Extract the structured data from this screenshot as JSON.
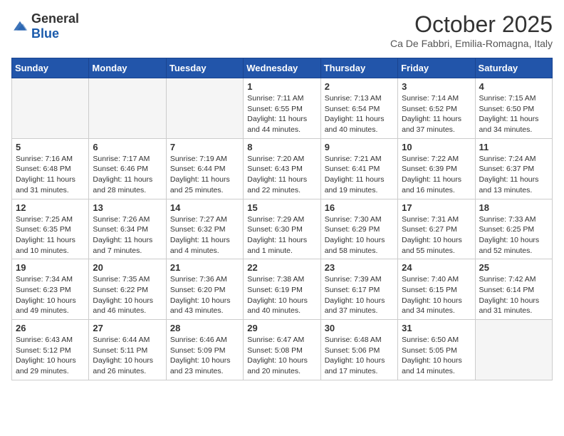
{
  "logo": {
    "general": "General",
    "blue": "Blue"
  },
  "title": "October 2025",
  "subtitle": "Ca De Fabbri, Emilia-Romagna, Italy",
  "days_of_week": [
    "Sunday",
    "Monday",
    "Tuesday",
    "Wednesday",
    "Thursday",
    "Friday",
    "Saturday"
  ],
  "weeks": [
    [
      {
        "day": "",
        "info": "",
        "empty": true
      },
      {
        "day": "",
        "info": "",
        "empty": true
      },
      {
        "day": "",
        "info": "",
        "empty": true
      },
      {
        "day": "1",
        "info": "Sunrise: 7:11 AM\nSunset: 6:55 PM\nDaylight: 11 hours and 44 minutes."
      },
      {
        "day": "2",
        "info": "Sunrise: 7:13 AM\nSunset: 6:54 PM\nDaylight: 11 hours and 40 minutes."
      },
      {
        "day": "3",
        "info": "Sunrise: 7:14 AM\nSunset: 6:52 PM\nDaylight: 11 hours and 37 minutes."
      },
      {
        "day": "4",
        "info": "Sunrise: 7:15 AM\nSunset: 6:50 PM\nDaylight: 11 hours and 34 minutes."
      }
    ],
    [
      {
        "day": "5",
        "info": "Sunrise: 7:16 AM\nSunset: 6:48 PM\nDaylight: 11 hours and 31 minutes."
      },
      {
        "day": "6",
        "info": "Sunrise: 7:17 AM\nSunset: 6:46 PM\nDaylight: 11 hours and 28 minutes."
      },
      {
        "day": "7",
        "info": "Sunrise: 7:19 AM\nSunset: 6:44 PM\nDaylight: 11 hours and 25 minutes."
      },
      {
        "day": "8",
        "info": "Sunrise: 7:20 AM\nSunset: 6:43 PM\nDaylight: 11 hours and 22 minutes."
      },
      {
        "day": "9",
        "info": "Sunrise: 7:21 AM\nSunset: 6:41 PM\nDaylight: 11 hours and 19 minutes."
      },
      {
        "day": "10",
        "info": "Sunrise: 7:22 AM\nSunset: 6:39 PM\nDaylight: 11 hours and 16 minutes."
      },
      {
        "day": "11",
        "info": "Sunrise: 7:24 AM\nSunset: 6:37 PM\nDaylight: 11 hours and 13 minutes."
      }
    ],
    [
      {
        "day": "12",
        "info": "Sunrise: 7:25 AM\nSunset: 6:35 PM\nDaylight: 11 hours and 10 minutes."
      },
      {
        "day": "13",
        "info": "Sunrise: 7:26 AM\nSunset: 6:34 PM\nDaylight: 11 hours and 7 minutes."
      },
      {
        "day": "14",
        "info": "Sunrise: 7:27 AM\nSunset: 6:32 PM\nDaylight: 11 hours and 4 minutes."
      },
      {
        "day": "15",
        "info": "Sunrise: 7:29 AM\nSunset: 6:30 PM\nDaylight: 11 hours and 1 minute."
      },
      {
        "day": "16",
        "info": "Sunrise: 7:30 AM\nSunset: 6:29 PM\nDaylight: 10 hours and 58 minutes."
      },
      {
        "day": "17",
        "info": "Sunrise: 7:31 AM\nSunset: 6:27 PM\nDaylight: 10 hours and 55 minutes."
      },
      {
        "day": "18",
        "info": "Sunrise: 7:33 AM\nSunset: 6:25 PM\nDaylight: 10 hours and 52 minutes."
      }
    ],
    [
      {
        "day": "19",
        "info": "Sunrise: 7:34 AM\nSunset: 6:23 PM\nDaylight: 10 hours and 49 minutes."
      },
      {
        "day": "20",
        "info": "Sunrise: 7:35 AM\nSunset: 6:22 PM\nDaylight: 10 hours and 46 minutes."
      },
      {
        "day": "21",
        "info": "Sunrise: 7:36 AM\nSunset: 6:20 PM\nDaylight: 10 hours and 43 minutes."
      },
      {
        "day": "22",
        "info": "Sunrise: 7:38 AM\nSunset: 6:19 PM\nDaylight: 10 hours and 40 minutes."
      },
      {
        "day": "23",
        "info": "Sunrise: 7:39 AM\nSunset: 6:17 PM\nDaylight: 10 hours and 37 minutes."
      },
      {
        "day": "24",
        "info": "Sunrise: 7:40 AM\nSunset: 6:15 PM\nDaylight: 10 hours and 34 minutes."
      },
      {
        "day": "25",
        "info": "Sunrise: 7:42 AM\nSunset: 6:14 PM\nDaylight: 10 hours and 31 minutes."
      }
    ],
    [
      {
        "day": "26",
        "info": "Sunrise: 6:43 AM\nSunset: 5:12 PM\nDaylight: 10 hours and 29 minutes."
      },
      {
        "day": "27",
        "info": "Sunrise: 6:44 AM\nSunset: 5:11 PM\nDaylight: 10 hours and 26 minutes."
      },
      {
        "day": "28",
        "info": "Sunrise: 6:46 AM\nSunset: 5:09 PM\nDaylight: 10 hours and 23 minutes."
      },
      {
        "day": "29",
        "info": "Sunrise: 6:47 AM\nSunset: 5:08 PM\nDaylight: 10 hours and 20 minutes."
      },
      {
        "day": "30",
        "info": "Sunrise: 6:48 AM\nSunset: 5:06 PM\nDaylight: 10 hours and 17 minutes."
      },
      {
        "day": "31",
        "info": "Sunrise: 6:50 AM\nSunset: 5:05 PM\nDaylight: 10 hours and 14 minutes."
      },
      {
        "day": "",
        "info": "",
        "empty": true
      }
    ]
  ]
}
